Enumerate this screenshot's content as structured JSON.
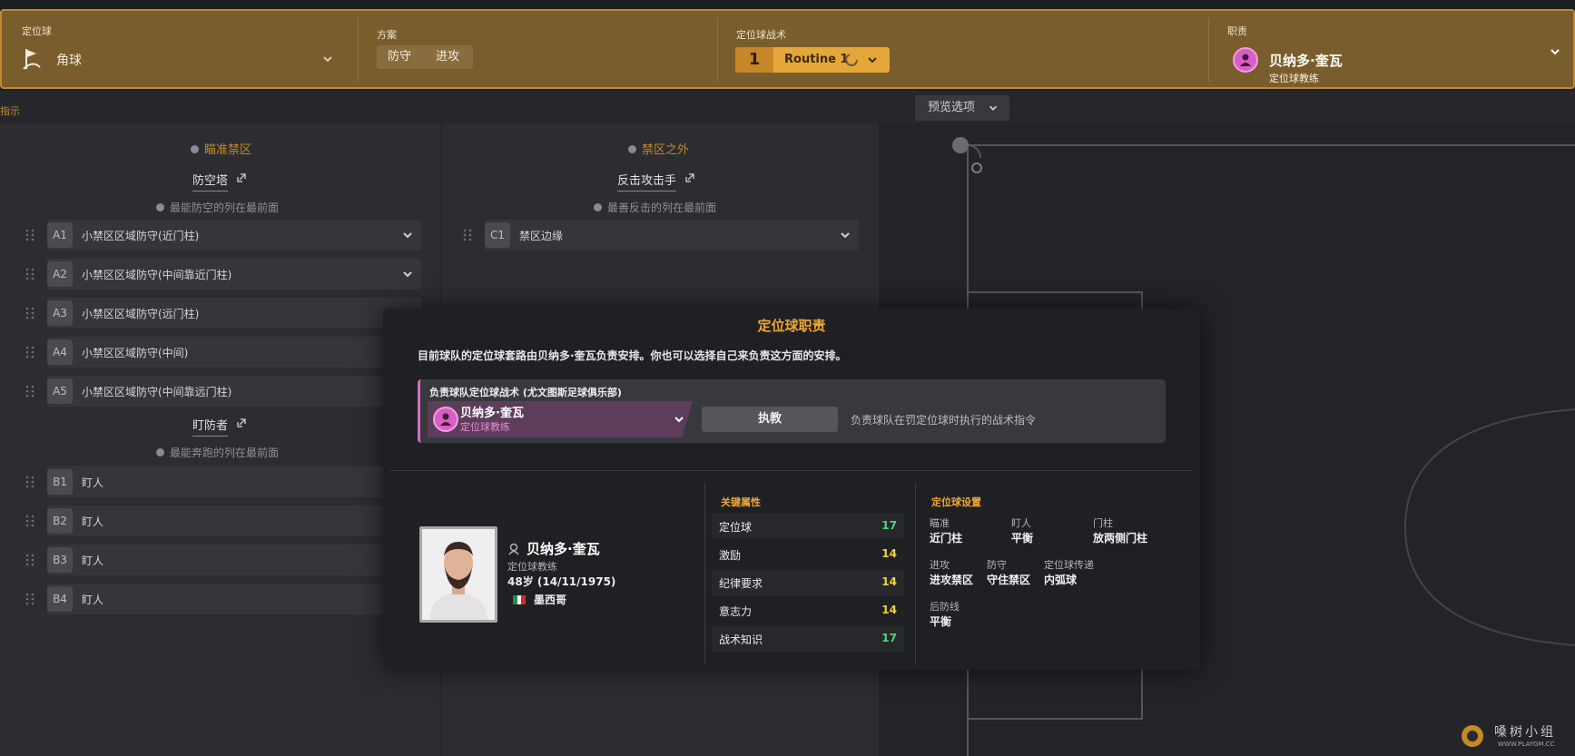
{
  "topbar": {
    "setpiece_label": "定位球",
    "setpiece_value": "角球",
    "plan_label": "方案",
    "plan_tabs": [
      "防守",
      "进攻"
    ],
    "tactic_label": "定位球战术",
    "routine_number": "1",
    "routine_name": "Routine 1",
    "resp_label": "职责",
    "resp_name": "贝纳多·奎瓦",
    "resp_role": "定位球教练"
  },
  "hint_link": "指示",
  "left_panel": {
    "zone_title": "瞄准禁区",
    "group_a": {
      "title": "防空塔",
      "hint": "最能防空的列在最前面"
    },
    "slots_a": [
      {
        "code": "A1",
        "label": "小禁区区域防守(近门柱)"
      },
      {
        "code": "A2",
        "label": "小禁区区域防守(中间靠近门柱)"
      },
      {
        "code": "A3",
        "label": "小禁区区域防守(远门柱)"
      },
      {
        "code": "A4",
        "label": "小禁区区域防守(中间)"
      },
      {
        "code": "A5",
        "label": "小禁区区域防守(中间靠远门柱)"
      }
    ],
    "group_b": {
      "title": "盯防者",
      "hint": "最能奔跑的列在最前面"
    },
    "slots_b": [
      {
        "code": "B1",
        "label": "盯人"
      },
      {
        "code": "B2",
        "label": "盯人"
      },
      {
        "code": "B3",
        "label": "盯人"
      },
      {
        "code": "B4",
        "label": "盯人"
      }
    ]
  },
  "mid_panel": {
    "zone_title": "禁区之外",
    "group_c": {
      "title": "反击攻击手",
      "hint": "最善反击的列在最前面"
    },
    "slots_c": [
      {
        "code": "C1",
        "label": "禁区边缘"
      }
    ]
  },
  "preview_label": "预览选项",
  "modal": {
    "title": "定位球职责",
    "description": "目前球队的定位球套路由贝纳多·奎瓦负责安排。你也可以选择自己来负责这方面的安排。",
    "assign_label": "负责球队定位球战术 (尤文图斯足球俱乐部)",
    "assign_name": "贝纳多·奎瓦",
    "assign_role": "定位球教练",
    "exec_button": "执教",
    "exec_desc": "负责球队在罚定位球时执行的战术指令",
    "person": {
      "name": "贝纳多·奎瓦",
      "role": "定位球教练",
      "age": "48岁 (14/11/1975)",
      "nation": "墨西哥"
    },
    "attributes_title": "关键属性",
    "attributes": [
      {
        "name": "定位球",
        "value": "17",
        "color": "#4fd67a"
      },
      {
        "name": "激励",
        "value": "14",
        "color": "#f1d43a"
      },
      {
        "name": "纪律要求",
        "value": "14",
        "color": "#f1d43a"
      },
      {
        "name": "意志力",
        "value": "14",
        "color": "#f1d43a"
      },
      {
        "name": "战术知识",
        "value": "17",
        "color": "#4fd67a"
      }
    ],
    "settings_title": "定位球设置",
    "settings": [
      {
        "label": "瞄准",
        "value": "近门柱"
      },
      {
        "label": "盯人",
        "value": "平衡"
      },
      {
        "label": "门柱",
        "value": "放两侧门柱"
      },
      {
        "label": "进攻",
        "value": "进攻禁区"
      },
      {
        "label": "防守",
        "value": "守住禁区"
      },
      {
        "label": "定位球传递",
        "value": "内弧球"
      },
      {
        "label": "后防线",
        "value": "平衡"
      }
    ]
  },
  "watermark": {
    "text": "嗓树小组",
    "sub": "WWW.PLAYGM.CC"
  },
  "colors": {
    "accent": "#c3882d",
    "topbar": "#7a5d2c",
    "routine": "#e5a63a",
    "coach": "#d85ec5"
  }
}
